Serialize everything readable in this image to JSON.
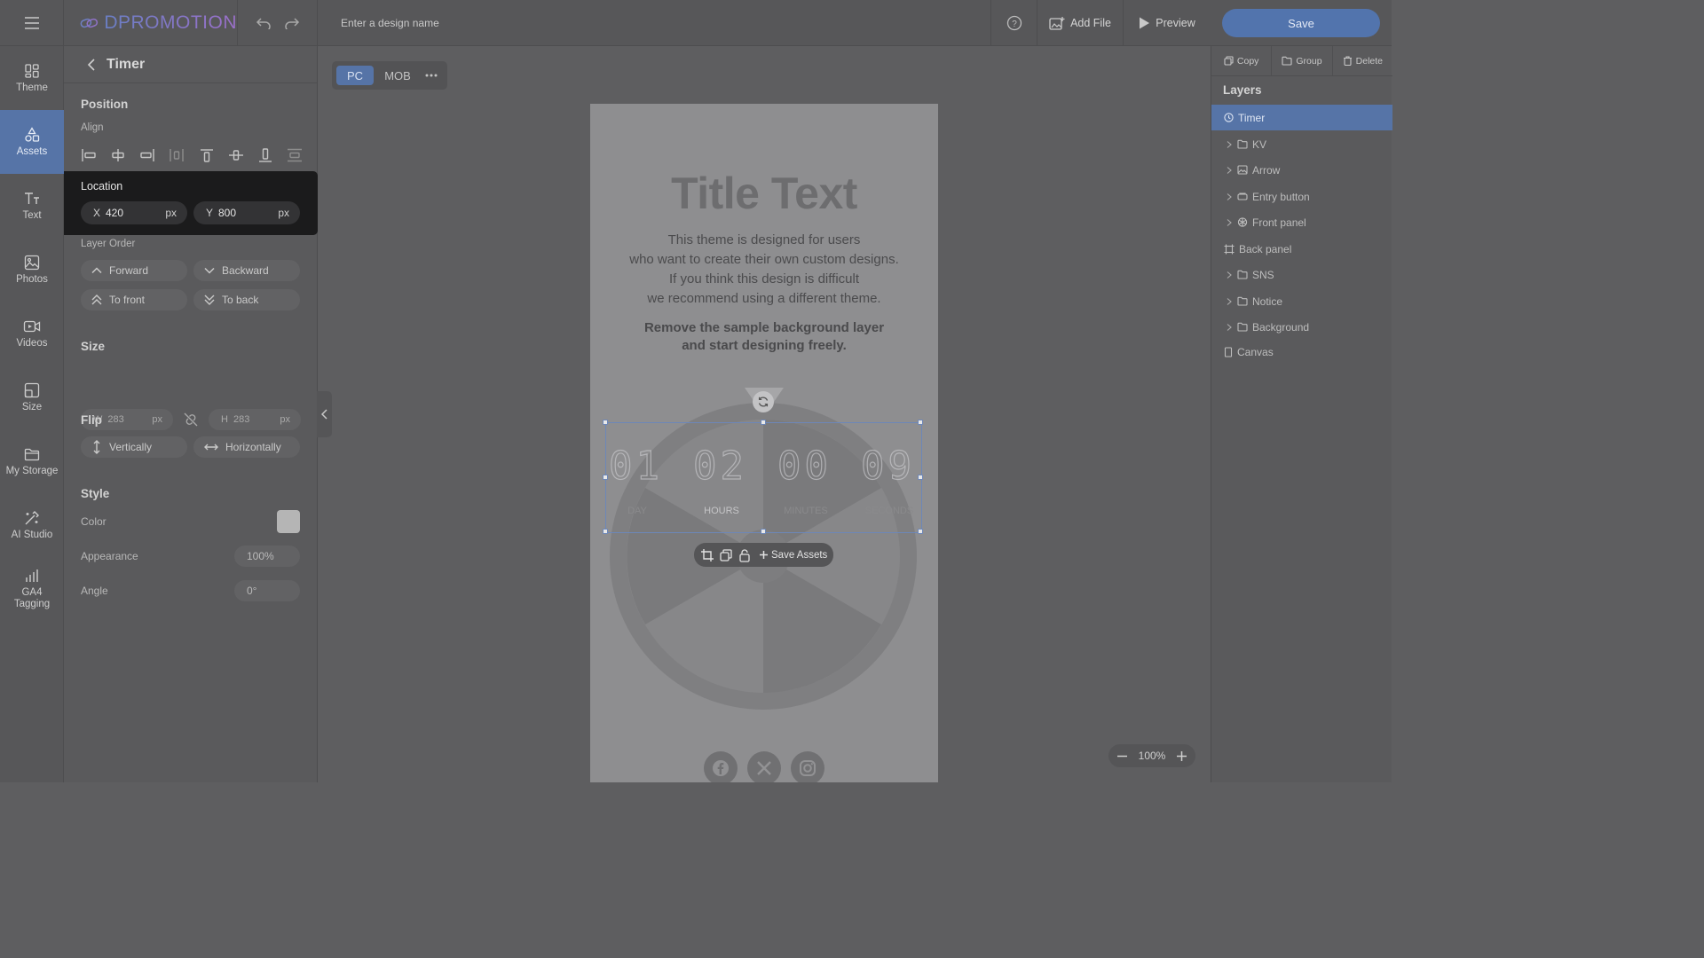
{
  "app": {
    "brand": "DPROMOTION",
    "design_name_placeholder": "Enter a design name",
    "add_file_label": "Add File",
    "preview_label": "Preview",
    "save_label": "Save"
  },
  "nav": {
    "items": [
      {
        "label": "Theme",
        "icon": "theme-icon"
      },
      {
        "label": "Assets",
        "icon": "assets-icon"
      },
      {
        "label": "Text",
        "icon": "text-icon"
      },
      {
        "label": "Photos",
        "icon": "photos-icon"
      },
      {
        "label": "Videos",
        "icon": "videos-icon"
      },
      {
        "label": "Size",
        "icon": "size-icon"
      },
      {
        "label": "My Storage",
        "icon": "folder-icon"
      },
      {
        "label": "AI Studio",
        "icon": "magic-wand-icon"
      },
      {
        "label": "GA4\nTagging",
        "icon": "bar-chart-icon"
      }
    ]
  },
  "props": {
    "title": "Timer",
    "position_title": "Position",
    "align_label": "Align",
    "location_title": "Location",
    "x_label": "X",
    "x_value": "420",
    "y_label": "Y",
    "y_value": "800",
    "unit": "px",
    "layer_order_label": "Layer Order",
    "forward": "Forward",
    "backward": "Backward",
    "to_front": "To front",
    "to_back": "To back",
    "size_title": "Size",
    "w_label": "W",
    "w_value": "283",
    "h_label": "H",
    "h_value": "283",
    "flip_title": "Flip",
    "vertically": "Vertically",
    "horizontally": "Horizontally",
    "style_title": "Style",
    "color_label": "Color",
    "color_value": "#b5b5b5",
    "appearance_label": "Appearance",
    "appearance_value": "100%",
    "angle_label": "Angle",
    "angle_value": "0°"
  },
  "view": {
    "pc": "PC",
    "mob": "MOB"
  },
  "design": {
    "title": "Title Text",
    "desc_lines": [
      "This theme is designed for users",
      "who want to create their own custom designs.",
      "If you think this design is difficult",
      "we recommend using a different theme."
    ],
    "bold_lines": [
      "Remove the sample background layer",
      "and start designing freely."
    ],
    "timer": {
      "digits": [
        "01",
        "02",
        "00",
        "09"
      ],
      "units": [
        "DAY",
        "HOURS",
        "MINUTES",
        "SECONDS"
      ]
    },
    "save_assets": "Save Assets"
  },
  "zoom": "100%",
  "right": {
    "copy": "Copy",
    "group": "Group",
    "delete": "Delete",
    "layers_title": "Layers",
    "layers": [
      {
        "name": "Timer",
        "icon": "clock-icon",
        "expandable": false,
        "active": true
      },
      {
        "name": "KV",
        "icon": "folder-icon",
        "expandable": true
      },
      {
        "name": "Arrow",
        "icon": "image-icon",
        "expandable": true
      },
      {
        "name": "Entry button",
        "icon": "button-icon",
        "expandable": true
      },
      {
        "name": "Front panel",
        "icon": "wheel-icon",
        "expandable": true
      },
      {
        "name": "Back panel",
        "icon": "frame-icon",
        "expandable": false
      },
      {
        "name": "SNS",
        "icon": "folder-icon",
        "expandable": true
      },
      {
        "name": "Notice",
        "icon": "folder-icon",
        "expandable": true
      },
      {
        "name": "Background",
        "icon": "folder-icon",
        "expandable": true
      },
      {
        "name": "Canvas",
        "icon": "page-icon",
        "expandable": false
      }
    ]
  }
}
